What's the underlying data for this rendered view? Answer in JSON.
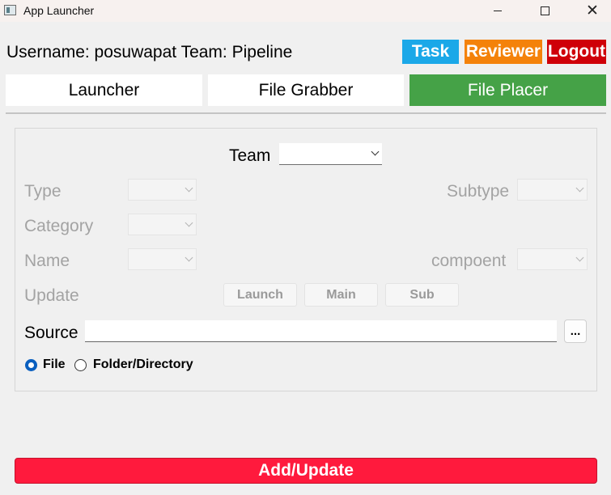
{
  "window": {
    "title": "App Launcher",
    "icon": "app-window-icon",
    "controls": {
      "minimize": "minimize-icon",
      "maximize": "maximize-icon",
      "close": "✕"
    }
  },
  "header": {
    "user_info": "Username: posuwapat Team: Pipeline",
    "task_label": "Task",
    "reviewer_label": "Reviewer",
    "logout_label": "Logout"
  },
  "tabs": [
    {
      "label": "Launcher",
      "active": false
    },
    {
      "label": "File Grabber",
      "active": false
    },
    {
      "label": "File Placer",
      "active": true
    }
  ],
  "form": {
    "team_label": "Team",
    "team_value": "",
    "type_label": "Type",
    "type_value": "",
    "subtype_label": "Subtype",
    "subtype_value": "",
    "category_label": "Category",
    "category_value": "",
    "name_label": "Name",
    "name_value": "",
    "component_label": "compoent",
    "component_value": "",
    "update_label": "Update",
    "update_buttons": [
      "Launch",
      "Main",
      "Sub"
    ],
    "source_label": "Source",
    "source_value": "",
    "browse_label": "...",
    "radio_file_label": "File",
    "radio_folder_label": "Folder/Directory",
    "selected_radio": "File"
  },
  "footer": {
    "add_update_label": "Add/Update"
  },
  "colors": {
    "task": "#1ba8e8",
    "reviewer": "#f4820a",
    "logout": "#cf0008",
    "active_tab": "#45a247",
    "add_update": "#ff1a3d",
    "radio_selected": "#0a5fbf"
  }
}
